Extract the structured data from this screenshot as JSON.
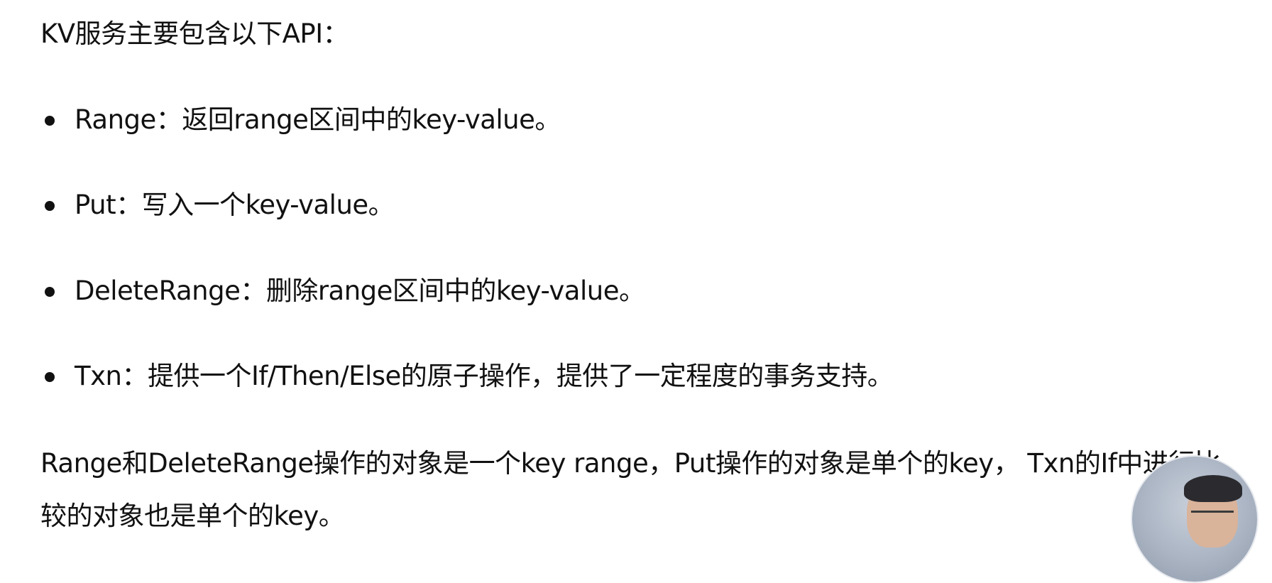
{
  "intro": "KV服务主要包含以下API：",
  "bullets": [
    "Range：返回range区间中的key-value。",
    "Put：写入一个key-value。",
    "DeleteRange：删除range区间中的key-value。",
    "Txn：提供一个If/Then/Else的原子操作，提供了一定程度的事务支持。"
  ],
  "summary": {
    "line1": "Range和DeleteRange操作的对象是一个key range，Put操作的对象是单个的key， Txn的If中进行比",
    "line2": "较的对象也是单个的key。"
  }
}
